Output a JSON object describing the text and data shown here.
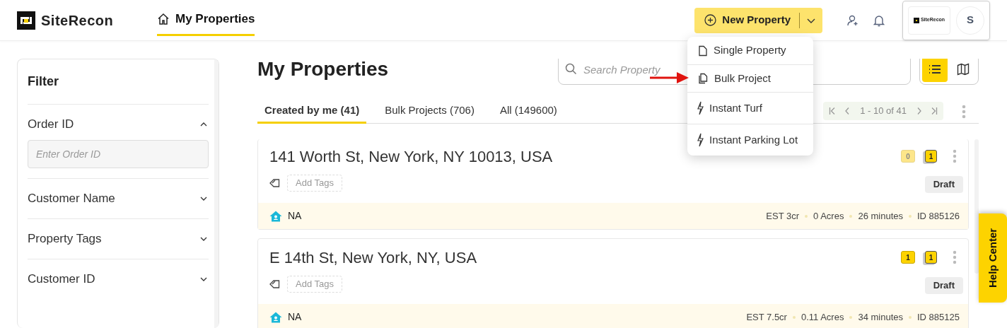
{
  "header": {
    "brand": "SiteRecon",
    "nav": [
      {
        "label": "My Properties",
        "selected": true
      }
    ],
    "new_button": "New Property",
    "account": {
      "logo_text": "SiteRecon",
      "avatar": "S"
    }
  },
  "menu": {
    "items": [
      {
        "kind": "file",
        "label": "Single Property"
      },
      {
        "kind": "files",
        "label": "Bulk Project"
      },
      {
        "kind": "bolt",
        "label": "Instant Turf"
      },
      {
        "kind": "bolt",
        "label": "Instant Parking Lot"
      }
    ]
  },
  "filter": {
    "title": "Filter",
    "sections": [
      {
        "label": "Order ID",
        "expanded": true,
        "placeholder": "Enter Order ID"
      },
      {
        "label": "Customer Name",
        "expanded": false
      },
      {
        "label": "Property Tags",
        "expanded": false
      },
      {
        "label": "Customer ID",
        "expanded": false
      }
    ]
  },
  "page_title": "My Properties",
  "search": {
    "placeholder": "Search Property"
  },
  "views": [
    {
      "kind": "list",
      "selected": true
    },
    {
      "kind": "map",
      "selected": false
    }
  ],
  "tabs": [
    {
      "label": "Created by me (41)",
      "selected": true
    },
    {
      "label": "Bulk Projects (706)",
      "selected": false
    },
    {
      "label": "All (149600)",
      "selected": false
    }
  ],
  "pagination": {
    "range": "1 - 10 of 41"
  },
  "properties": [
    {
      "address": "141 Worth St, New York, NY 10013, USA",
      "add_tags": "Add Tags",
      "comments": {
        "count": "0",
        "active": false
      },
      "versions": "1",
      "status": "Draft",
      "customer": "NA",
      "estimate": "EST 3cr",
      "area": "0 Acres",
      "age": "26 minutes",
      "id": "ID 885126"
    },
    {
      "address": "E 14th St, New York, NY, USA",
      "add_tags": "Add Tags",
      "comments": {
        "count": "1",
        "active": true
      },
      "versions": "1",
      "status": "Draft",
      "customer": "NA",
      "estimate": "EST 7.5cr",
      "area": "0.11 Acres",
      "age": "34 minutes",
      "id": "ID 885125"
    }
  ],
  "help": "Help Center"
}
